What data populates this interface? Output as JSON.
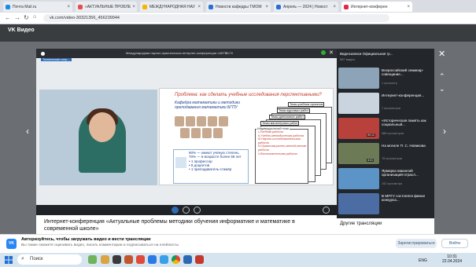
{
  "browser": {
    "tabs": [
      {
        "label": "Почта Mail.ru",
        "color": "#168de2"
      },
      {
        "label": "«АКТУАЛЬНЫЕ ПРОБЛЕ",
        "color": "#e94c4c"
      },
      {
        "label": "МЕЖДУНАРОДНАЯ НАУ",
        "color": "#f5b400"
      },
      {
        "label": "Новости кафедры ТМОМ",
        "color": "#2a6ed5"
      },
      {
        "label": "Апрель — 2024 | Новост",
        "color": "#2a6ed5"
      },
      {
        "label": "Интернет-конферен",
        "color": "#e2264d"
      }
    ],
    "url": "vk.com/video-30321356_456239944"
  },
  "vk": {
    "logo": "VK Видео"
  },
  "player": {
    "header_title": "Международная научно-практическая интернет-конференция «АКТУ...",
    "timer": "30:70",
    "channel_badge": "Технические сопр...",
    "slide": {
      "title": "Проблема: как сделать учебные исследования перспективными?",
      "subtitle": "Кафедра математики и методики преподавания математики БГПУ",
      "card_labels": [
        "Темы учебных проектов",
        "Темы курсовых работ",
        "Темы дипломных работ",
        "Темы магистерских работ",
        "Индивидуальный план"
      ],
      "plan_items": [
        "I.Учебная работа",
        "II.Учебно-методическая работа",
        "III.Научно-исследовательская работа",
        "IV.Организационно-методическая работа",
        "V.Воспитательная работа"
      ],
      "stats": [
        "90% — имеют учёную степень",
        "70% — в возрасте более 58 лет",
        "• 1 профессор",
        "• 8 доцентов",
        "• 1 преподаватель-стажёр"
      ]
    },
    "video_title": "Интернет-конференция «Актуальные проблемы методики обучения информатике и математике в современной школе»"
  },
  "sidebar": {
    "header": "Видеозаписи Официальная гр...",
    "subheader": "587 видео",
    "videos": [
      {
        "title": "Всероссийский семинар-совещание...",
        "meta": "1 просмотр",
        "duration": "",
        "thumb": "#8da3b8"
      },
      {
        "title": "Интернет-конференция...",
        "meta": "7 просмотров",
        "duration": "",
        "thumb": "#c9d4de"
      },
      {
        "title": "«Историческая память как социальный...",
        "meta": "588 просмотров",
        "duration": "59:12",
        "thumb": "#b9413c"
      },
      {
        "title": "На могиле П. С. Новикова",
        "meta": "78 просмотров",
        "duration": "3:21",
        "thumb": "#6c7a55"
      },
      {
        "title": "Ярмарка вакансий организаций-отрасл...",
        "meta": "152 просмотра",
        "duration": "",
        "thumb": "#5d94c7"
      },
      {
        "title": "В МПГУ состоялся финал конкурса...",
        "meta": "",
        "duration": "",
        "thumb": "#4b6da3"
      }
    ],
    "other_label": "Другие трансляции"
  },
  "notification": {
    "icon": "VK",
    "title": "Авторизуйтесь, чтобы загружать видео и вести трансляции",
    "text": "Вы также сможете оценивать видео, писать комментарии и подписываться на плейлисты",
    "allow_label": "Зарегистрироваться",
    "login_label": "Войти"
  },
  "watermark": "Активация Windows",
  "taskbar": {
    "search_placeholder": "Поиск",
    "lang": "ENG",
    "time": "10:31",
    "date": "22.04.2024"
  }
}
